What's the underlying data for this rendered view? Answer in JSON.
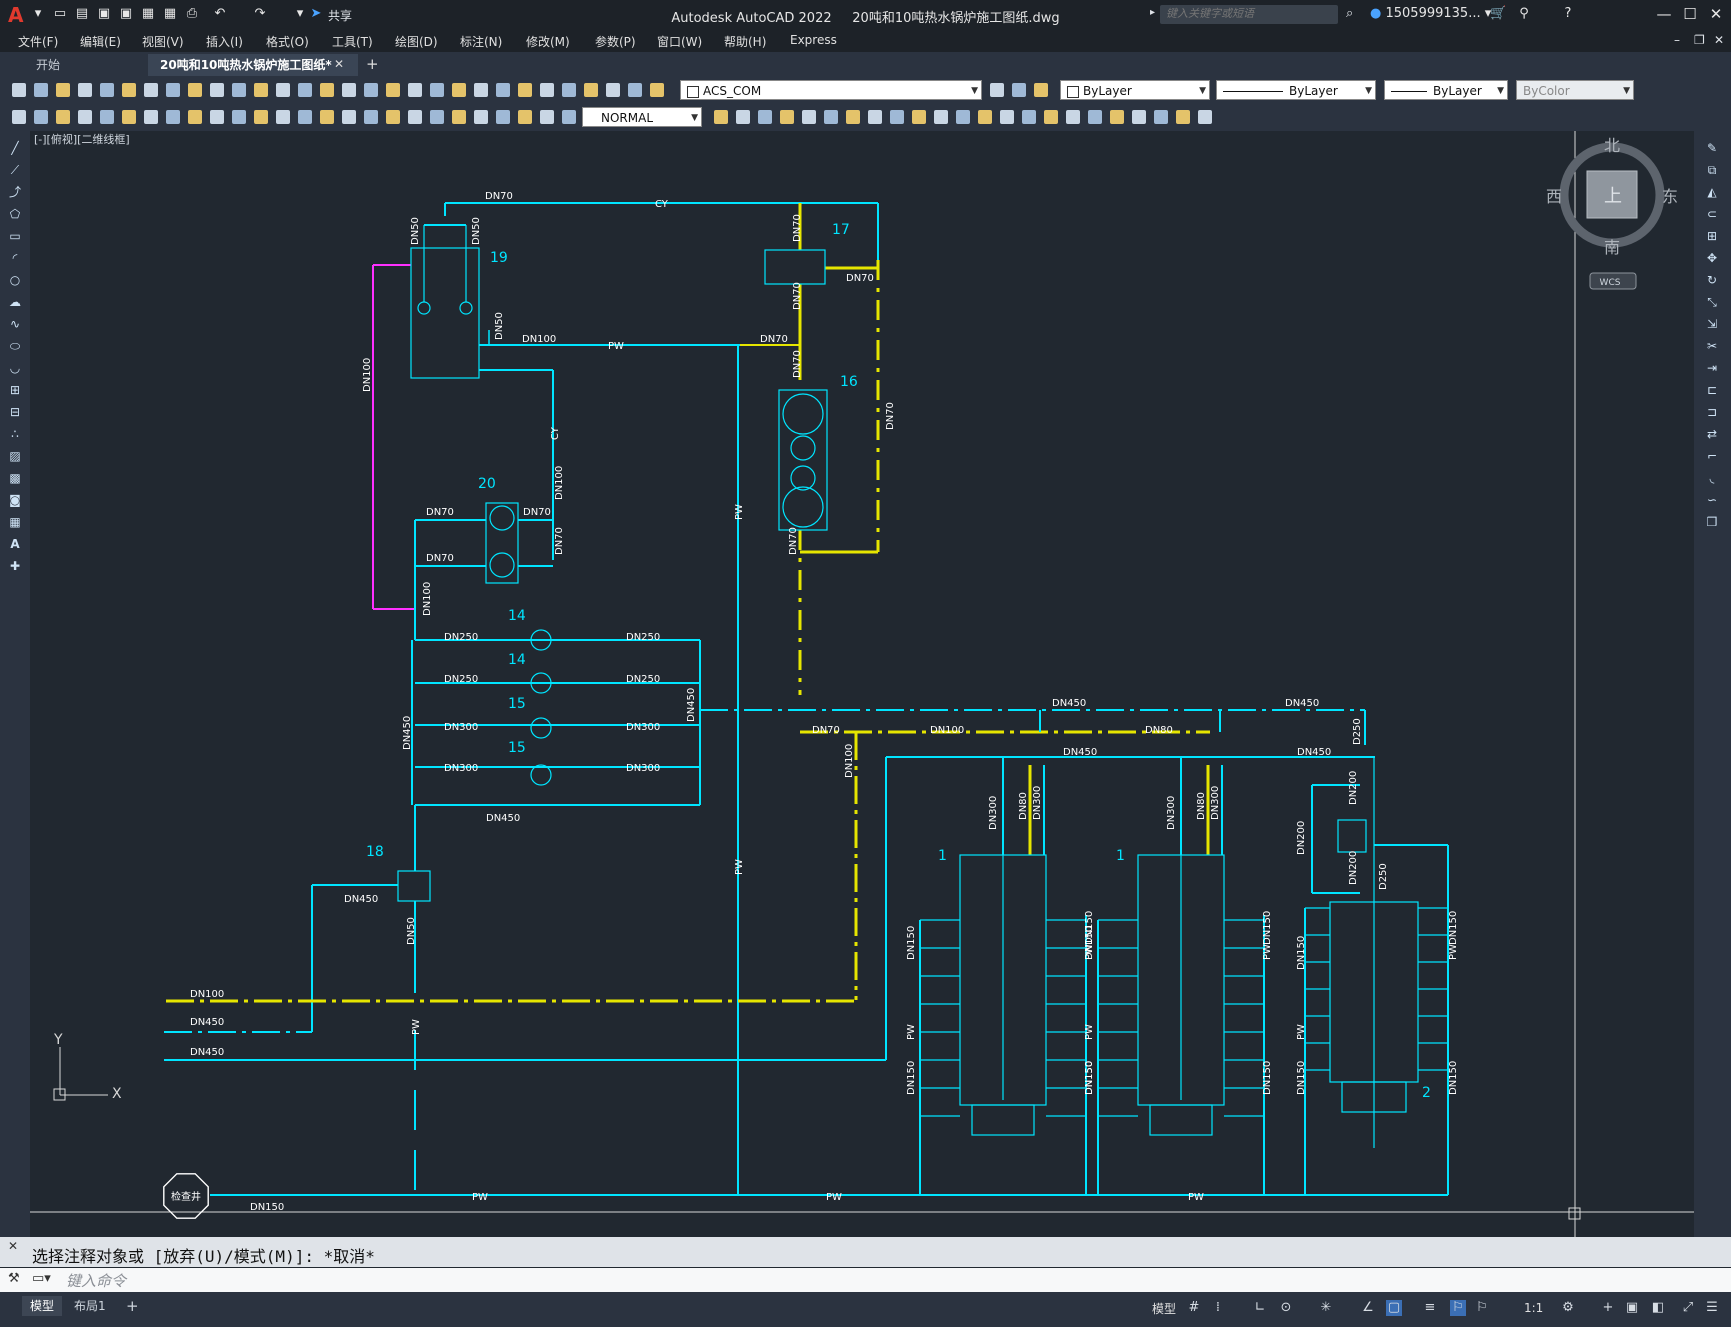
{
  "titlebar": {
    "app_title": "Autodesk AutoCAD 2022",
    "file_name": "20吨和10吨热水锅炉施工图纸.dwg",
    "share_label": "共享",
    "search_placeholder": "键入关键字或短语",
    "user_name": "1505999135..."
  },
  "menu": [
    "文件(F)",
    "编辑(E)",
    "视图(V)",
    "插入(I)",
    "格式(O)",
    "工具(T)",
    "绘图(D)",
    "标注(N)",
    "修改(M)",
    "参数(P)",
    "窗口(W)",
    "帮助(H)",
    "Express"
  ],
  "tabs": {
    "start": "开始",
    "document": "20吨和10吨热水锅炉施工图纸*"
  },
  "toolbar": {
    "layer_name": "ACS_COM",
    "color": "ByLayer",
    "linetype": "ByLayer",
    "lineweight": "ByLayer",
    "plot_style": "ByColor",
    "text_style": "NORMAL"
  },
  "viewport": {
    "view_label": "[-][俯视][二维线框]",
    "compass": {
      "north": "北",
      "south": "南",
      "east": "东",
      "west": "西",
      "center": "上"
    },
    "wcs": "WCS",
    "ucs_x": "X",
    "ucs_y": "Y"
  },
  "drawing": {
    "labels": {
      "dn70": "DN70",
      "dn50": "DN50",
      "dn100": "DN100",
      "dn150": "DN150",
      "dn200": "DN200",
      "dn250": "DN250",
      "dn300": "DN300",
      "dn450": "DN450",
      "dn80": "DN80",
      "d250": "D250",
      "cy": "CY",
      "pw": "PW",
      "n1": "1",
      "n2": "2",
      "n14": "14",
      "n15": "15",
      "n16": "16",
      "n17": "17",
      "n18": "18",
      "n19": "19",
      "n20": "20",
      "well": "检查井"
    }
  },
  "command": {
    "history": "选择注释对象或 [放弃(U)/模式(M)]: *取消*",
    "placeholder": "键入命令"
  },
  "status": {
    "model_tab": "模型",
    "layout_tab": "布局1",
    "model_label": "模型",
    "scale": "1:1"
  },
  "colors": {
    "pipe_cyan": "#00e5ff",
    "pipe_yellow": "#e6e600",
    "pipe_magenta": "#ff30ff",
    "background": "#212830"
  }
}
